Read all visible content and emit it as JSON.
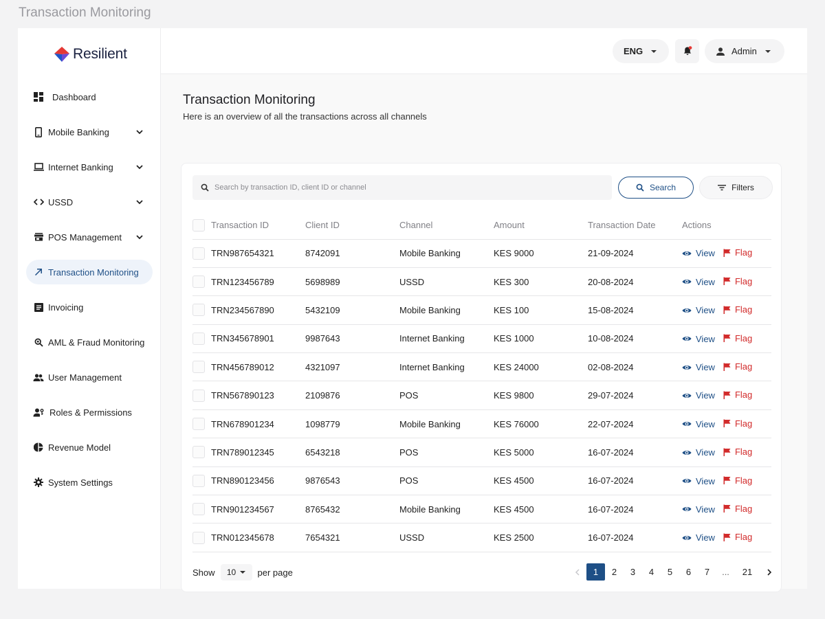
{
  "page_caption": "Transaction Monitoring",
  "brand": {
    "name": "Resilient"
  },
  "sidebar": {
    "items": [
      {
        "label": "Dashboard",
        "icon": "dashboard-icon",
        "expandable": false,
        "active": false
      },
      {
        "label": "Mobile Banking",
        "icon": "mobile-phone-icon",
        "expandable": true,
        "active": false
      },
      {
        "label": "Internet Banking",
        "icon": "laptop-icon",
        "expandable": true,
        "active": false
      },
      {
        "label": "USSD",
        "icon": "code-icon",
        "expandable": true,
        "active": false
      },
      {
        "label": "POS Management",
        "icon": "store-icon",
        "expandable": true,
        "active": false
      },
      {
        "label": "Transaction Monitoring",
        "icon": "trend-arrow-icon",
        "expandable": false,
        "active": true
      },
      {
        "label": "Invoicing",
        "icon": "receipt-icon",
        "expandable": false,
        "active": false
      },
      {
        "label": "AML & Fraud Monitoring",
        "icon": "magnify-icon",
        "expandable": false,
        "active": false
      },
      {
        "label": "User Management",
        "icon": "users-icon",
        "expandable": false,
        "active": false
      },
      {
        "label": "Roles & Permissions",
        "icon": "user-key-icon",
        "expandable": false,
        "active": false
      },
      {
        "label": "Revenue Model",
        "icon": "pie-chart-icon",
        "expandable": false,
        "active": false
      },
      {
        "label": "System Settings",
        "icon": "gear-icon",
        "expandable": false,
        "active": false
      }
    ]
  },
  "topbar": {
    "language": "ENG",
    "user": "Admin"
  },
  "main": {
    "title": "Transaction Monitoring",
    "subtitle": "Here is an overview of all the transactions across all channels",
    "search": {
      "placeholder": "Search by transaction ID, client ID or channel",
      "button_label": "Search"
    },
    "filters_label": "Filters",
    "table": {
      "columns": [
        "Transaction ID",
        "Client ID",
        "Channel",
        "Amount",
        "Transaction Date",
        "Actions"
      ],
      "view_label": "View",
      "flag_label": "Flag",
      "rows": [
        {
          "transaction_id": "TRN987654321",
          "client_id": "8742091",
          "channel": "Mobile Banking",
          "amount": "KES 9000",
          "date": "21-09-2024"
        },
        {
          "transaction_id": "TRN123456789",
          "client_id": "5698989",
          "channel": "USSD",
          "amount": "KES 300",
          "date": "20-08-2024"
        },
        {
          "transaction_id": "TRN234567890",
          "client_id": "5432109",
          "channel": "Mobile Banking",
          "amount": "KES 100",
          "date": "15-08-2024"
        },
        {
          "transaction_id": "TRN345678901",
          "client_id": "9987643",
          "channel": "Internet Banking",
          "amount": "KES 1000",
          "date": "10-08-2024"
        },
        {
          "transaction_id": "TRN456789012",
          "client_id": "4321097",
          "channel": "Internet Banking",
          "amount": "KES 24000",
          "date": "02-08-2024"
        },
        {
          "transaction_id": "TRN567890123",
          "client_id": "2109876",
          "channel": "POS",
          "amount": "KES 9800",
          "date": "29-07-2024"
        },
        {
          "transaction_id": "TRN678901234",
          "client_id": "1098779",
          "channel": "Mobile Banking",
          "amount": "KES 76000",
          "date": "22-07-2024"
        },
        {
          "transaction_id": "TRN789012345",
          "client_id": "6543218",
          "channel": "POS",
          "amount": "KES 5000",
          "date": "16-07-2024"
        },
        {
          "transaction_id": "TRN890123456",
          "client_id": "9876543",
          "channel": "POS",
          "amount": "KES 4500",
          "date": "16-07-2024"
        },
        {
          "transaction_id": "TRN901234567",
          "client_id": "8765432",
          "channel": "Mobile Banking",
          "amount": "KES 4500",
          "date": "16-07-2024"
        },
        {
          "transaction_id": "TRN012345678",
          "client_id": "7654321",
          "channel": "USSD",
          "amount": "KES 2500",
          "date": "16-07-2024"
        }
      ]
    },
    "pagination": {
      "show_label": "Show",
      "per_page_value": "10",
      "per_page_label": "per page",
      "pages": [
        "1",
        "2",
        "3",
        "4",
        "5",
        "6",
        "7",
        "...",
        "21"
      ],
      "current_page": "1"
    }
  },
  "colors": {
    "accent": "#1e4f86",
    "flag": "#d22b2b",
    "logo_red": "#e53935",
    "logo_blue": "#1e56c8"
  }
}
